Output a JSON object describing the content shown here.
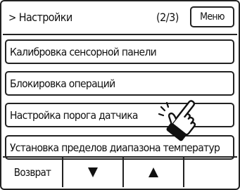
{
  "header": {
    "breadcrumb_chevron": ">",
    "title": "Настройки",
    "page_indicator": "(2/3)",
    "menu_label": "Меню"
  },
  "items": [
    {
      "label": "Калибровка сенсорной панели"
    },
    {
      "label": "Блокировка операций"
    },
    {
      "label": "Настройка порога датчика"
    },
    {
      "label": "Установка пределов диапазона температур"
    }
  ],
  "footer": {
    "back_label": "Возврат",
    "down_icon": "triangle-down-icon",
    "up_icon": "triangle-up-icon"
  },
  "overlay": {
    "icon": "pointing-hand-icon"
  }
}
